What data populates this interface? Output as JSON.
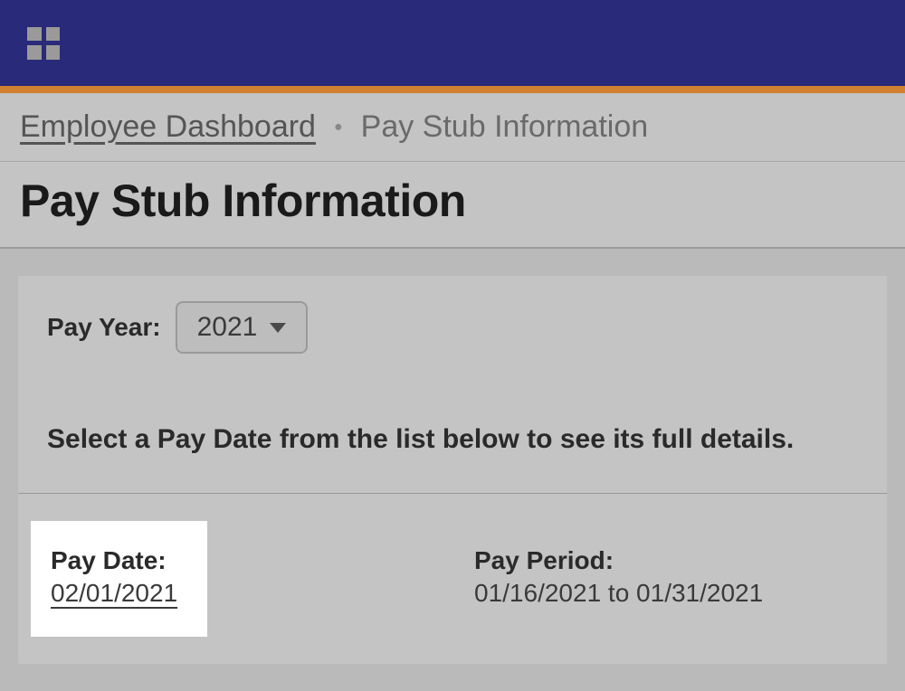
{
  "breadcrumb": {
    "link_label": "Employee Dashboard",
    "current_label": "Pay Stub Information"
  },
  "page": {
    "title": "Pay Stub Information"
  },
  "pay_year": {
    "label": "Pay Year:",
    "selected": "2021"
  },
  "instruction": "Select a Pay Date from the list below to see its full details.",
  "pay_stub": {
    "pay_date_label": "Pay Date:",
    "pay_date_value": "02/01/2021",
    "pay_period_label": "Pay Period:",
    "pay_period_value": "01/16/2021 to 01/31/2021"
  }
}
